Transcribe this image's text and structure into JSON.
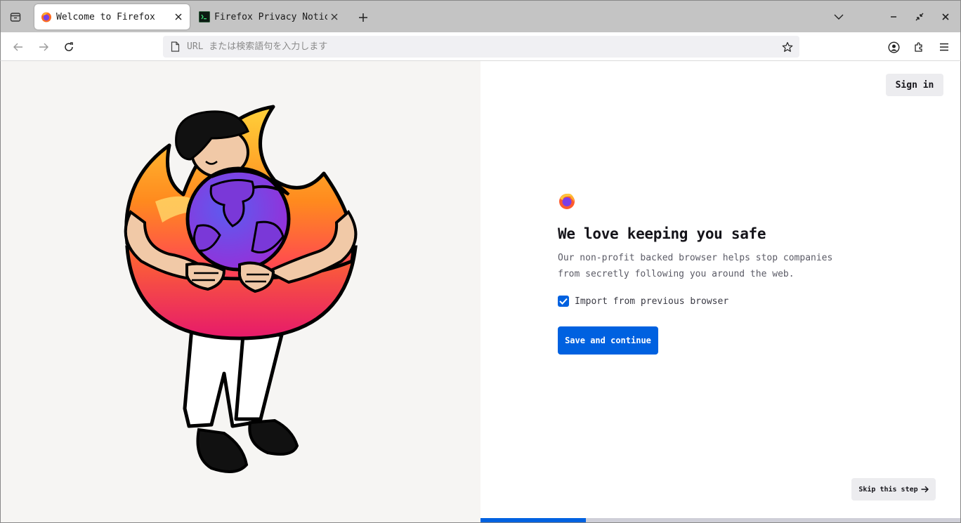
{
  "tabs": [
    {
      "title": "Welcome to Firefox",
      "favicon": "firefox-icon",
      "active": true
    },
    {
      "title": "Firefox Privacy Notice —",
      "favicon": "terminal-icon",
      "active": false
    }
  ],
  "urlbar": {
    "placeholder": "URL または検索語句を入力します",
    "value": ""
  },
  "page": {
    "sign_in_label": "Sign in",
    "heading": "We love keeping you safe",
    "subtext_line1": "Our non-profit backed browser helps stop companies",
    "subtext_line2": "from secretly following you around the web.",
    "import_label": "Import from previous browser",
    "import_checked": true,
    "primary_label": "Save and continue",
    "skip_label": "Skip this step",
    "progress": 0.22
  },
  "colors": {
    "accent": "#0061e0",
    "illustration_bg": "#f6f5f3"
  }
}
